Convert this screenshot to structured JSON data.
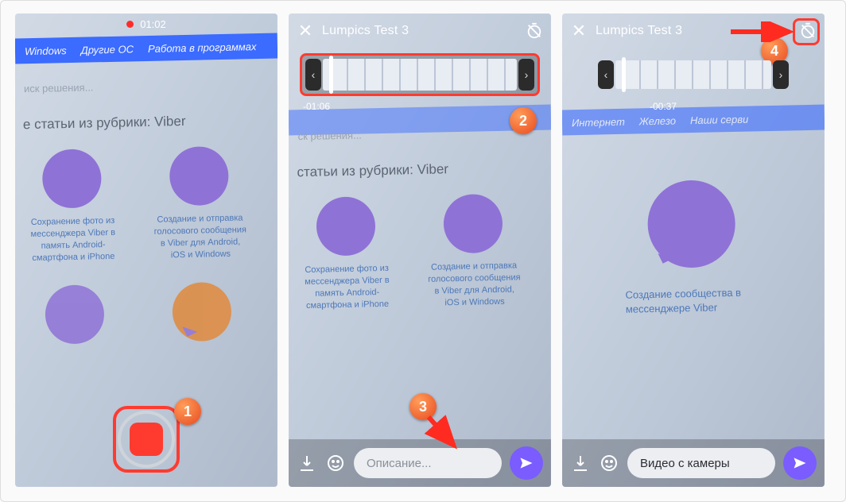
{
  "screen1": {
    "rec_time": "01:02",
    "nav_items": [
      "Windows",
      "Другие ОС",
      "Работа в программах"
    ],
    "search_placeholder": "иск решения...",
    "rubric": "е статьи из рубрики: Viber",
    "card1": "Сохранение фото из мессенджера Viber в память Android-смартфона и iPhone",
    "card2": "Создание и отправка голосового сообщения в Viber для Android, iOS и Windows",
    "badge": "1"
  },
  "screen2": {
    "title": "Lumpics Test 3",
    "timecode": "-01:06",
    "rubric": "статьи из рубрики: Viber",
    "card1": "Сохранение фото из мессенджера Viber в память Android-смартфона и iPhone",
    "card2": "Создание и отправка голосового сообщения в Viber для Android, iOS и Windows",
    "caption_placeholder": "Описание...",
    "badge_strip": "2",
    "badge_input": "3"
  },
  "screen3": {
    "title": "Lumpics Test 3",
    "timecode": "-00:37",
    "nav_items": [
      "Интернет",
      "Железо",
      "Наши серви"
    ],
    "card_big": "Создание сообщества в мессенджере Viber",
    "input_text": "Видео с камеры",
    "badge_timer": "4"
  },
  "icons": {
    "close": "close-icon",
    "timer": "timer-off-icon",
    "download": "download-icon",
    "emoji": "emoji-icon",
    "send": "send-icon"
  }
}
